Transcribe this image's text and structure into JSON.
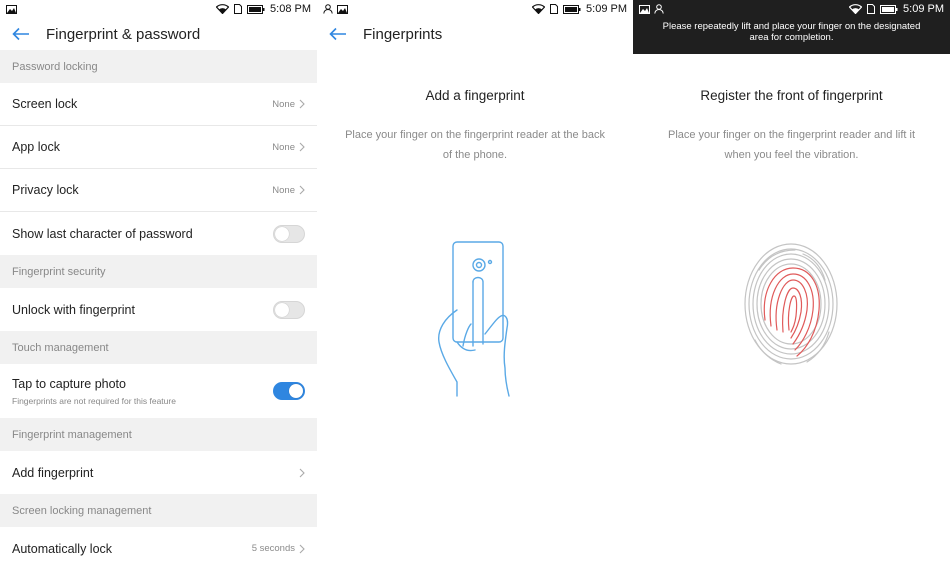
{
  "screen1": {
    "status_time": "5:08 PM",
    "title": "Fingerprint & password",
    "sections": {
      "password_locking": "Password locking",
      "fingerprint_security": "Fingerprint security",
      "touch_management": "Touch management",
      "fingerprint_management": "Fingerprint management",
      "screen_locking_management": "Screen locking management"
    },
    "rows": {
      "screen_lock": {
        "label": "Screen lock",
        "value": "None"
      },
      "app_lock": {
        "label": "App lock",
        "value": "None"
      },
      "privacy_lock": {
        "label": "Privacy lock",
        "value": "None"
      },
      "show_last_char": {
        "label": "Show last character of password",
        "toggle": false
      },
      "unlock_fingerprint": {
        "label": "Unlock with fingerprint",
        "toggle": false
      },
      "tap_capture": {
        "label": "Tap to capture photo",
        "sub": "Fingerprints are not required for this feature",
        "toggle": true
      },
      "add_fingerprint": {
        "label": "Add fingerprint"
      },
      "auto_lock": {
        "label": "Automatically lock",
        "value": "5 seconds"
      }
    }
  },
  "screen2": {
    "status_time": "5:09 PM",
    "title": "Fingerprints",
    "heading": "Add a fingerprint",
    "description": "Place your finger on the fingerprint reader at the back of the phone."
  },
  "screen3": {
    "status_time": "5:09 PM",
    "toast": "Please repeatedly lift and place your finger on the designated area for completion.",
    "heading": "Register the front of fingerprint",
    "description": "Place your finger on the fingerprint reader and lift it when you feel the vibration."
  },
  "colors": {
    "accent": "#2f86e0",
    "section_bg": "#f1f1f1",
    "fingerprint_progress": "#e05a5a",
    "illustration": "#5aa9e6"
  },
  "icons": [
    "back-arrow-icon",
    "wifi-icon",
    "battery-icon",
    "image-icon",
    "person-icon",
    "sim-icon",
    "chevron-right-icon",
    "phone-hand-icon",
    "fingerprint-icon"
  ]
}
